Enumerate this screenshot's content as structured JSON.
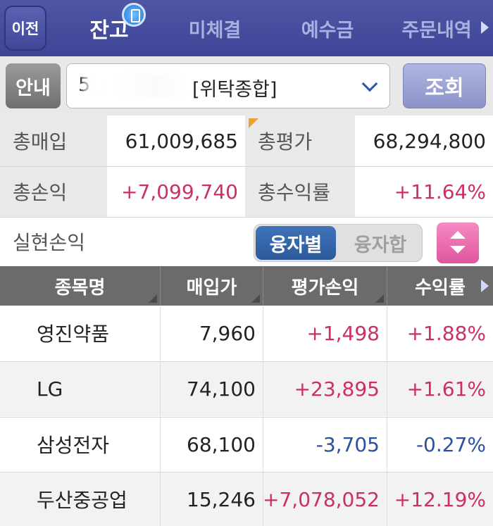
{
  "nav": {
    "back_label": "이전",
    "tabs": [
      {
        "label": "잔고",
        "active": true
      },
      {
        "label": "미체결",
        "active": false
      },
      {
        "label": "예수금",
        "active": false
      },
      {
        "label": "주문내역",
        "active": false
      }
    ]
  },
  "account": {
    "guide_label": "안내",
    "number_visible": "5",
    "type": "[위탁종합]",
    "query_label": "조회"
  },
  "summary": {
    "total_purchase_label": "총매입",
    "total_purchase": "61,009,685",
    "total_eval_label": "총평가",
    "total_eval": "68,294,800",
    "total_pl_label": "총손익",
    "total_pl": "+7,099,740",
    "total_return_label": "총수익률",
    "total_return": "+11.64%",
    "realized_label": "실현손익",
    "realized": "",
    "toggle_on": "융자별",
    "toggle_off": "융자합"
  },
  "table": {
    "headers": [
      "종목명",
      "매입가",
      "평가손익",
      "수익률"
    ],
    "rows": [
      {
        "name": "영진약품",
        "price": "7,960",
        "pl": "+1,498",
        "ret": "+1.88%",
        "sign": "up"
      },
      {
        "name": "LG",
        "price": "74,100",
        "pl": "+23,895",
        "ret": "+1.61%",
        "sign": "up"
      },
      {
        "name": "삼성전자",
        "price": "68,100",
        "pl": "-3,705",
        "ret": "-0.27%",
        "sign": "down"
      },
      {
        "name": "두산중공업",
        "price": "15,246",
        "pl": "+7,078,052",
        "ret": "+12.19%",
        "sign": "up"
      }
    ]
  },
  "colors": {
    "nav_bg": "#4a51a1",
    "positive": "#cc2f66",
    "negative": "#2c4fa0",
    "table_header": "#6b6b6b"
  }
}
